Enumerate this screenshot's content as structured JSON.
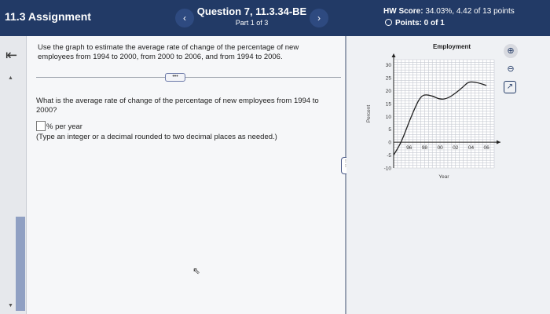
{
  "header": {
    "assignment_title": "11.3 Assignment",
    "question_title": "Question 7, 11.3.34-BE",
    "question_part": "Part 1 of 3",
    "prev_glyph": "‹",
    "next_glyph": "›",
    "hw_score_label": "HW Score:",
    "hw_score_value": "34.03%, 4.42 of 13 points",
    "points_label": "Points:",
    "points_value": "0 of 1"
  },
  "question": {
    "instructions": "Use the graph to estimate the average rate of change of the percentage of new employees from 1994 to 2000, from 2000 to 2006, and from 1994 to 2006.",
    "more_label": "•••",
    "prompt": "What is the average rate of change of the percentage of new employees from 1994 to 2000?",
    "answer_value": "",
    "answer_unit": "% per year",
    "hint": "(Type an integer or a decimal rounded to two decimal places as needed.)"
  },
  "chart_data": {
    "type": "line",
    "title": "Employment",
    "xlabel": "Year",
    "ylabel": "Percent",
    "x_ticks": [
      "96",
      "98",
      "00",
      "02",
      "04",
      "06"
    ],
    "y_ticks": [
      30,
      25,
      20,
      15,
      10,
      5,
      0,
      -5,
      -10
    ],
    "xlim": [
      1994,
      2007
    ],
    "ylim": [
      -10,
      32
    ],
    "grid": true,
    "series": [
      {
        "color": "#222222",
        "x": [
          1994,
          1995,
          1996,
          1997,
          1997.5,
          1998,
          1999,
          2000,
          2001,
          2002,
          2003,
          2003.5,
          2004,
          2005,
          2006
        ],
        "y": [
          -5,
          0,
          8,
          15,
          17.5,
          18.5,
          18,
          16.5,
          17,
          19,
          21.5,
          23,
          23.5,
          23,
          22
        ]
      }
    ]
  },
  "icons": {
    "back": "back-arrow-icon",
    "zoom_in": "zoom-in-icon",
    "zoom_out": "zoom-out-icon",
    "popout": "popout-icon"
  }
}
